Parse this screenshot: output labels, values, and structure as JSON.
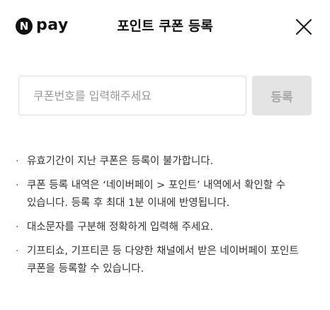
{
  "header": {
    "logo_mark": "N",
    "logo_text": "pay",
    "title": "포인트 쿠폰 등록",
    "close_icon": "close-icon"
  },
  "form": {
    "placeholder": "쿠폰번호를 입력해주세요",
    "value": "",
    "register_label": "등록",
    "register_disabled": true
  },
  "notes": [
    "유효기간이 지난 쿠폰은 등록이 불가합니다.",
    "쿠폰 등록 내역은 ‘네이버페이 > 포인트’ 내역에서 확인할 수 있습니다. 등록 후 최대 1분 이내에 반영됩니다.",
    "대소문자를 구분해 정확하게 입력해 주세요.",
    "기프티쇼, 기프티콘 등 다양한 채널에서 받은 네이버페이 포인트 쿠폰을 등록할 수 있습니다."
  ],
  "colors": {
    "text": "#222222",
    "button_disabled_bg": "#e4e4e4",
    "button_disabled_text": "#a8a8a8",
    "input_border": "#dddddd"
  }
}
